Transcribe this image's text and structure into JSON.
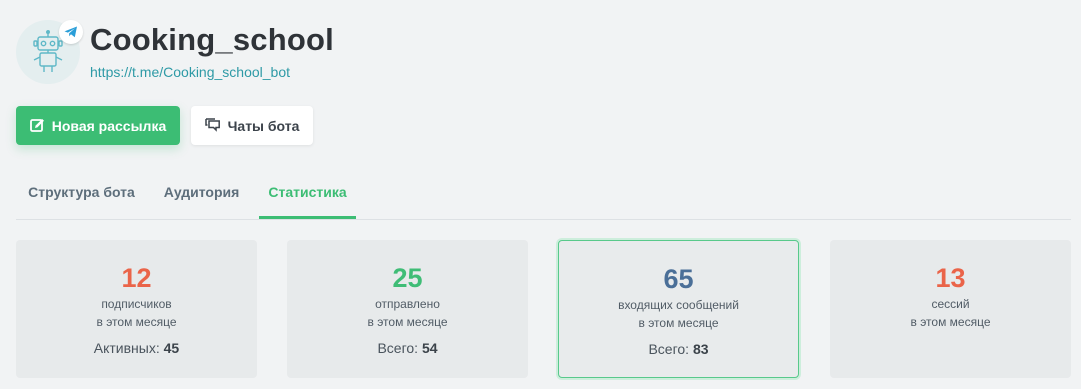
{
  "bot": {
    "name": "Cooking_school",
    "link": "https://t.me/Cooking_school_bot"
  },
  "buttons": {
    "new_mailing": "Новая рассылка",
    "bot_chats": "Чаты бота"
  },
  "tabs": [
    {
      "label": "Структура бота",
      "active": false
    },
    {
      "label": "Аудитория",
      "active": false
    },
    {
      "label": "Статистика",
      "active": true
    }
  ],
  "stats": [
    {
      "value": "12",
      "line1": "подписчиков",
      "line2": "в этом месяце",
      "footer_label": "Активных:",
      "footer_value": "45",
      "color": "#ea6449"
    },
    {
      "value": "25",
      "line1": "отправлено",
      "line2": "в этом месяце",
      "footer_label": "Всего:",
      "footer_value": "54",
      "color": "#3fbd76"
    },
    {
      "value": "65",
      "line1": "входящих сообщений",
      "line2": "в этом месяце",
      "footer_label": "Всего:",
      "footer_value": "83",
      "color": "#4a6f98"
    },
    {
      "value": "13",
      "line1": "сессий",
      "line2": "в этом месяце",
      "footer_label": "",
      "footer_value": "",
      "color": "#ea6449"
    }
  ],
  "icons": {
    "avatar": "robot-icon",
    "badge": "telegram-icon",
    "new_mailing": "edit-icon",
    "bot_chats": "chat-bubbles-icon"
  },
  "colors": {
    "accent": "#3cbd74",
    "link": "#2e9aa6"
  }
}
